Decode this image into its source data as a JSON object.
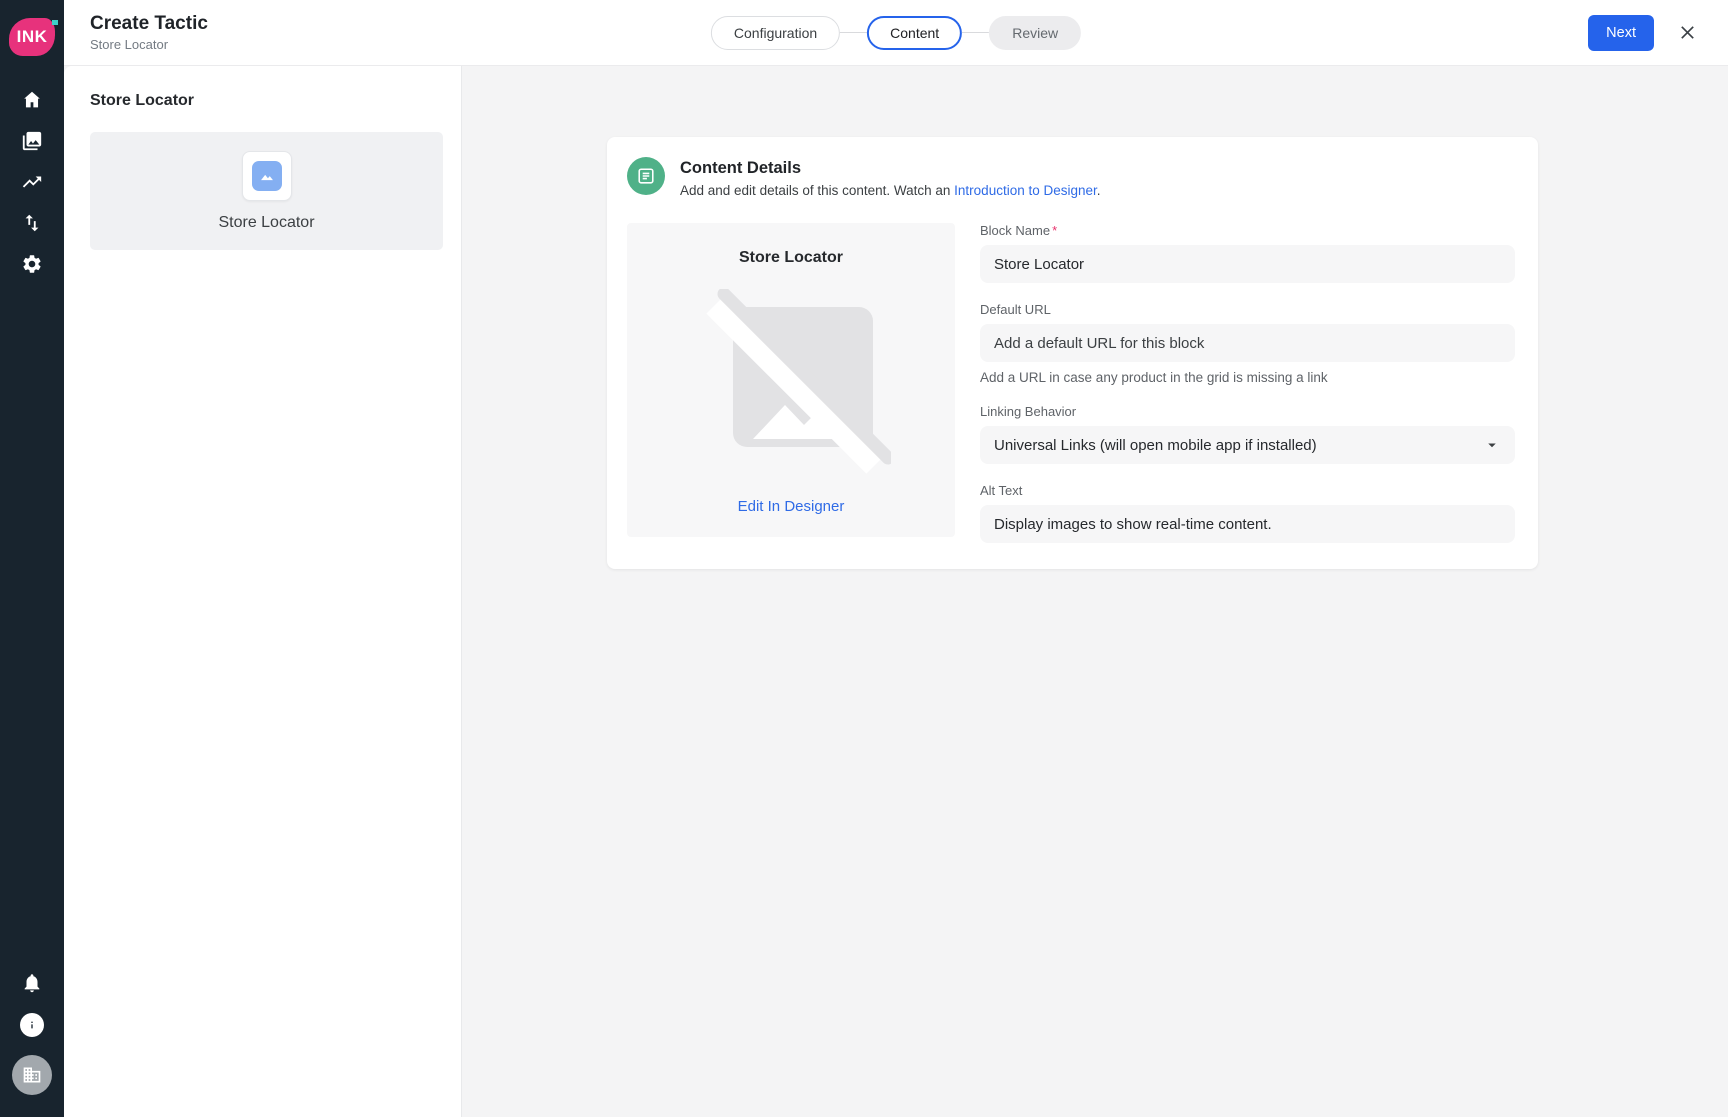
{
  "brand": {
    "logo_text": "INK",
    "logo_color": "#e7327c"
  },
  "header": {
    "title": "Create Tactic",
    "subtitle": "Store Locator",
    "stepper": {
      "steps": [
        {
          "label": "Configuration",
          "state": "default"
        },
        {
          "label": "Content",
          "state": "active"
        },
        {
          "label": "Review",
          "state": "upcoming"
        }
      ]
    },
    "next_button_label": "Next"
  },
  "sidebar": {
    "nav_icons": [
      "home-icon",
      "photo-library-icon",
      "trending-up-icon",
      "swap-vertical-icon",
      "settings-gear-icon"
    ],
    "bottom_icons": [
      "notifications-bell-icon",
      "info-icon",
      "organization-avatar-building-icon"
    ]
  },
  "block_panel": {
    "heading": "Store Locator",
    "tile": {
      "icon": "image-icon",
      "label": "Store Locator"
    }
  },
  "content_card": {
    "icon": "content-details-list-icon",
    "title": "Content Details",
    "description_prefix": "Add and edit details of this content. Watch an ",
    "description_link": "Introduction to Designer",
    "description_suffix": ".",
    "preview": {
      "title": "Store Locator",
      "icon": "broken-image-icon",
      "edit_link_label": "Edit In Designer"
    },
    "form": {
      "block_name": {
        "label": "Block Name",
        "required_marker": "*",
        "value": "Store Locator"
      },
      "default_url": {
        "label": "Default URL",
        "placeholder": "Add a default URL for this block",
        "helper": "Add a URL in case any product in the grid is missing a link"
      },
      "linking_behavior": {
        "label": "Linking Behavior",
        "value": "Universal Links (will open mobile app if installed)"
      },
      "alt_text": {
        "label": "Alt Text",
        "value": "Display images to show real-time content."
      }
    }
  },
  "colors": {
    "accent_blue": "#2563eb",
    "link_blue": "#2f6be6",
    "brand_pink": "#e7327c",
    "icon_green": "#4fb188",
    "sidebar_bg": "#18242e"
  }
}
